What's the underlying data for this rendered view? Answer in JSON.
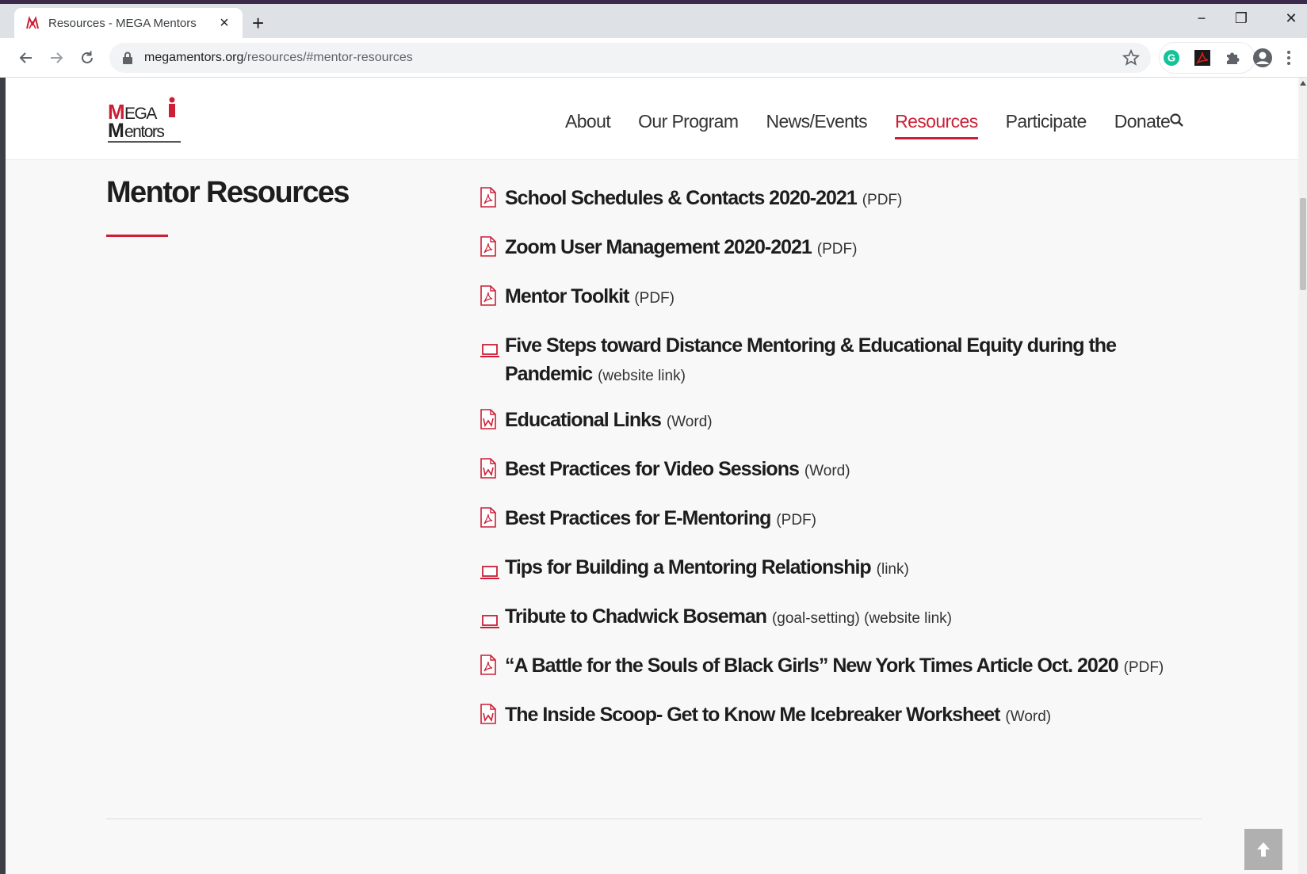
{
  "browser": {
    "tab_title": "Resources - MEGA Mentors",
    "tab_close": "×",
    "new_tab": "+",
    "url_host": "megamentors.org",
    "url_path": "/resources/#mentor-resources",
    "window_controls": {
      "minimize": "−",
      "restore": "❐",
      "close": "✕"
    },
    "extensions": [
      "grammarly-icon",
      "acrobat-icon",
      "puzzle-icon",
      "profile-icon",
      "kebab-menu-icon"
    ]
  },
  "site": {
    "logo_text": "MEGA Mentors",
    "nav": [
      {
        "label": "About"
      },
      {
        "label": "Our Program"
      },
      {
        "label": "News/Events"
      },
      {
        "label": "Resources",
        "active": true
      },
      {
        "label": "Participate"
      },
      {
        "label": "Donate"
      }
    ]
  },
  "section": {
    "title": "Mentor Resources",
    "items": [
      {
        "title": "School Schedules & Contacts 2020-2021",
        "type": "(PDF)",
        "icon": "pdf-icon"
      },
      {
        "title": "Zoom User Management 2020-2021",
        "type": "(PDF)",
        "icon": "pdf-icon"
      },
      {
        "title": "Mentor Toolkit",
        "type": "(PDF)",
        "icon": "pdf-icon"
      },
      {
        "title": "Five Steps toward Distance Mentoring & Educational Equity during the Pandemic",
        "type": "(website link)",
        "icon": "laptop-icon"
      },
      {
        "title": "Educational Links",
        "type": "(Word)",
        "icon": "word-icon"
      },
      {
        "title": "Best Practices for Video Sessions",
        "type": "(Word)",
        "icon": "word-icon"
      },
      {
        "title": "Best Practices for E-Mentoring",
        "type": "(PDF)",
        "icon": "pdf-icon"
      },
      {
        "title": "Tips for Building a Mentoring Relationship",
        "type": "(link)",
        "icon": "laptop-icon"
      },
      {
        "title": "Tribute to Chadwick Boseman",
        "type": "(goal-setting) (website link)",
        "icon": "laptop-icon"
      },
      {
        "title": "“A Battle for the Souls of Black Girls” New York Times Article Oct. 2020",
        "type": "(PDF)",
        "icon": "pdf-icon"
      },
      {
        "title": "The Inside Scoop- Get to Know Me Icebreaker Worksheet",
        "type": "(Word)",
        "icon": "word-icon"
      }
    ]
  },
  "colors": {
    "accent": "#cc1f36",
    "text": "#1d1d1d",
    "page_bg": "#f8f8f8"
  }
}
